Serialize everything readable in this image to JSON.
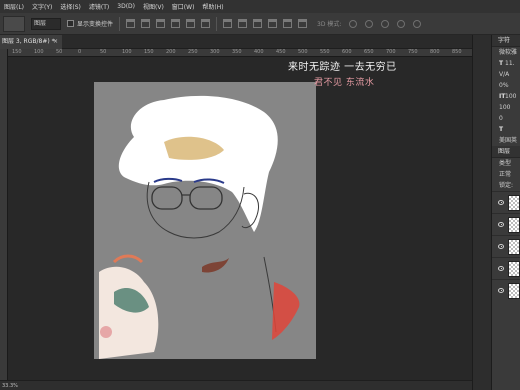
{
  "menubar": {
    "items": [
      "图层(L)",
      "文字(Y)",
      "选择(S)",
      "滤镜(T)",
      "3D(D)",
      "视图(V)",
      "窗口(W)",
      "帮助(H)"
    ]
  },
  "options": {
    "auto_select_value": "图层",
    "show_transform_label": "显示变换控件",
    "mode_3d_label": "3D 模式:"
  },
  "document": {
    "tab_title": "图层 3, RGB/8#) *",
    "close_glyph": "×",
    "zoom_status": "33.3%"
  },
  "rulers": {
    "top_ticks": [
      "150",
      "100",
      "50",
      "0",
      "50",
      "100",
      "150",
      "200",
      "250",
      "300",
      "350",
      "400",
      "450",
      "500",
      "550",
      "600",
      "650",
      "700",
      "750",
      "800",
      "850",
      "900"
    ]
  },
  "canvas_text": {
    "line1": "来时无踪迹 一去无穷已",
    "line2": "君不见 东流水"
  },
  "right_panel": {
    "character_tab": "字符",
    "font_family": "微软雅",
    "size_value": "11.",
    "tracking": "V/A",
    "scale_pct": "0%",
    "vscale": "100",
    "hscale": "100",
    "baseline": "0",
    "type_icon": "T",
    "language": "美国英",
    "layers_tab": "图层",
    "layer_kind": "类型",
    "blend_mode": "正常",
    "lock_label": "锁定:"
  },
  "colors": {
    "accent_pink": "#e79ca4",
    "canvas_gray": "#868686",
    "app_bg": "#282828"
  }
}
